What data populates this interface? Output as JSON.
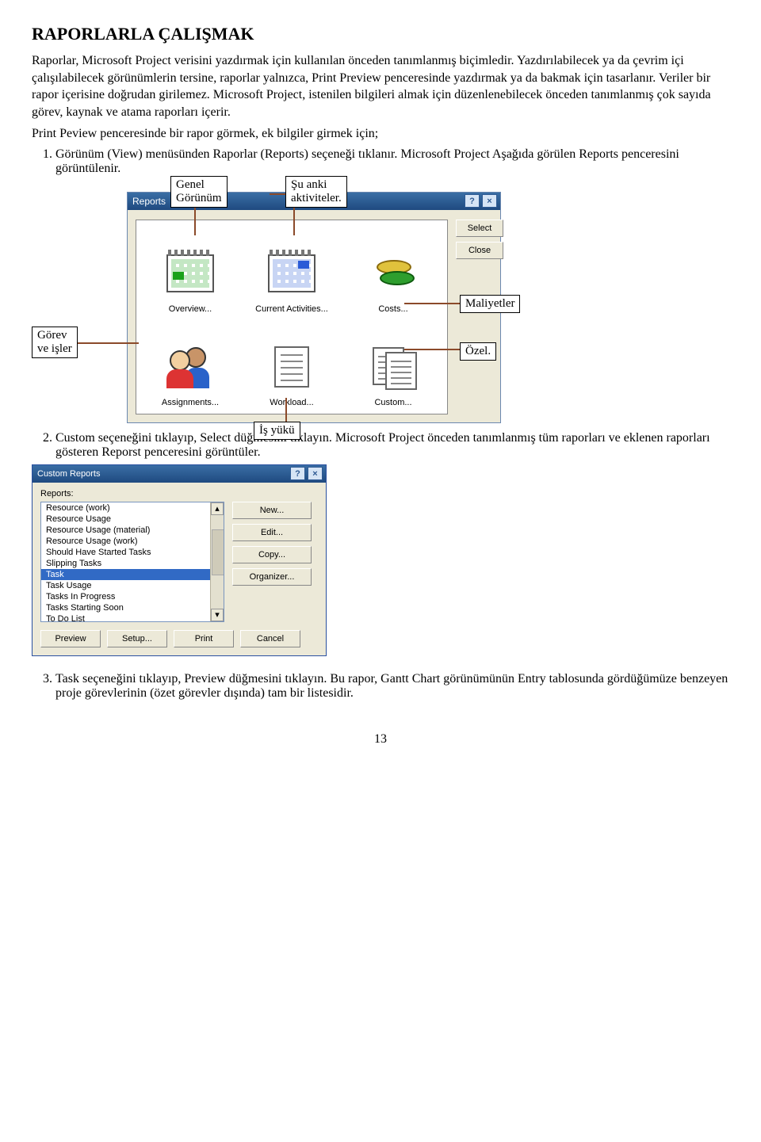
{
  "heading": "RAPORLARLA ÇALIŞMAK",
  "intro_p1": "Raporlar, Microsoft Project verisini yazdırmak için kullanılan önceden tanımlanmış biçimledir. Yazdırılabilecek ya da çevrim içi çalışılabilecek görünümlerin tersine, raporlar yalnızca, Print Preview penceresinde yazdırmak ya da bakmak için tasarlanır. Veriler bir rapor içerisine doğrudan girilemez. Microsoft Project, istenilen bilgileri almak için düzenlenebilecek önceden tanımlanmış çok sayıda görev, kaynak ve atama raporları içerir.",
  "intro_p2": "Print Peview penceresinde bir rapor görmek, ek bilgiler girmek için;",
  "step1": "Görünüm (View) menüsünden Raporlar (Reports)  seçeneği tıklanır. Microsoft Project Aşağıda görülen Reports penceresini görüntülenir.",
  "callouts": {
    "gorev": "Görev\nve işler",
    "genel": "Genel\nGörünüm",
    "suanki": "Şu anki\naktiviteler.",
    "maliyet": "Maliyetler",
    "ozel": "Özel.",
    "isyuku": "İş yükü"
  },
  "reports_dialog": {
    "title": "Reports",
    "btn_help": "?",
    "btn_close": "×",
    "tiles": {
      "overview": "Overview...",
      "current": "Current Activities...",
      "costs": "Costs...",
      "assignments": "Assignments...",
      "workload": "Workload...",
      "custom": "Custom..."
    },
    "side": {
      "select": "Select",
      "close": "Close"
    }
  },
  "step2": "Custom seçeneğini tıklayıp, Select düğmesini tıklayın. Microsoft Project önceden tanımlanmış tüm raporları ve eklenen raporları gösteren Reporst penceresini görüntüler.",
  "custom_reports": {
    "title": "Custom Reports",
    "label": "Reports:",
    "items": [
      "Resource (work)",
      "Resource Usage",
      "Resource Usage (material)",
      "Resource Usage (work)",
      "Should Have Started Tasks",
      "Slipping Tasks",
      "Task",
      "Task Usage",
      "Tasks In Progress",
      "Tasks Starting Soon",
      "To Do List"
    ],
    "selected_index": 6,
    "side": {
      "new": "New...",
      "edit": "Edit...",
      "copy": "Copy...",
      "organizer": "Organizer..."
    },
    "bottom": {
      "preview": "Preview",
      "setup": "Setup...",
      "print": "Print",
      "cancel": "Cancel"
    }
  },
  "step3": "Task seçeneğini tıklayıp, Preview düğmesini tıklayın. Bu rapor, Gantt Chart görünümünün Entry tablosunda gördüğümüze benzeyen proje görevlerinin (özet görevler dışında) tam bir listesidir.",
  "page_number": "13"
}
